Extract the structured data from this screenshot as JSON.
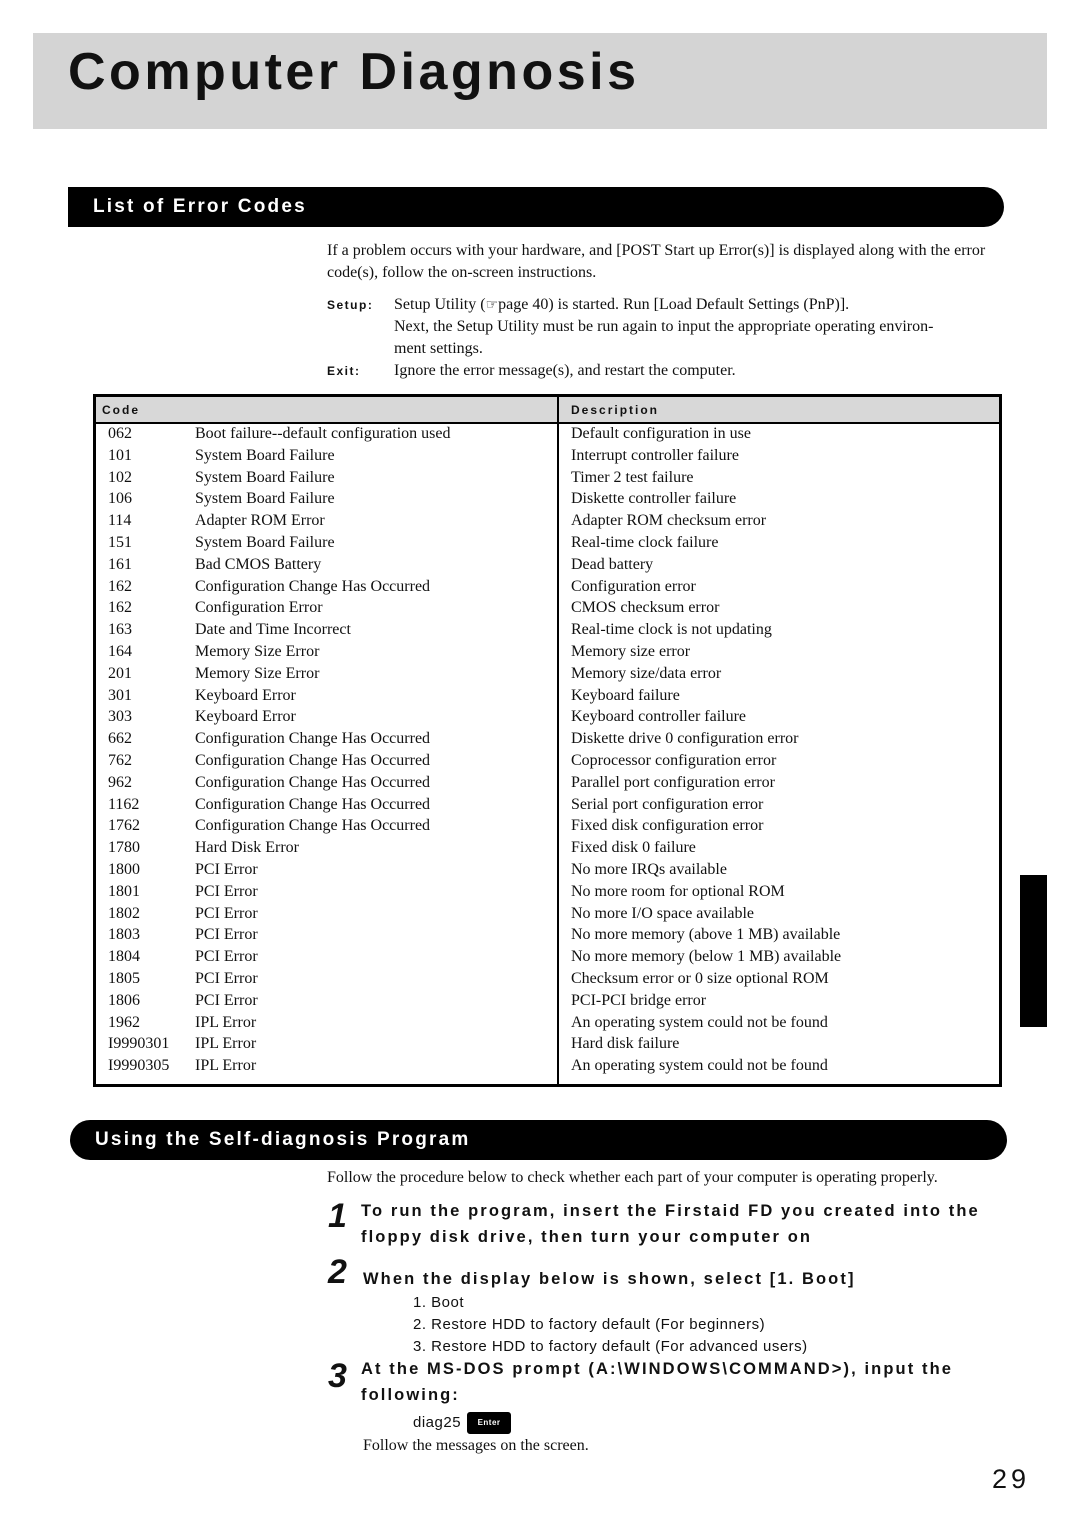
{
  "title": "Computer Diagnosis",
  "section1": {
    "heading": "List of Error Codes",
    "intro": "If a problem occurs with your hardware, and [POST Start up Error(s)] is displayed along with the error code(s), follow the on-screen instructions.",
    "setup_label": "Setup",
    "setup_line1_a": "Setup Utility (",
    "setup_icon": "pointing-hand-icon",
    "setup_line1_b": "page 40) is started. Run [Load Default Settings (PnP)].",
    "setup_line2": "Next, the Setup Utility must be run again to input the appropriate operating environ-",
    "setup_line3": "ment settings.",
    "exit_label": "Exit",
    "exit_text": "Ignore the error message(s), and restart the computer."
  },
  "table": {
    "headers": [
      "Code",
      "Description"
    ],
    "rows": [
      [
        "062",
        "Boot failure--default configuration used",
        "Default configuration in use"
      ],
      [
        "101",
        "System Board Failure",
        "Interrupt controller failure"
      ],
      [
        "102",
        "System Board Failure",
        "Timer 2 test failure"
      ],
      [
        "106",
        "System Board Failure",
        "Diskette controller failure"
      ],
      [
        "114",
        "Adapter ROM Error",
        "Adapter ROM checksum error"
      ],
      [
        "151",
        "System Board Failure",
        "Real-time clock failure"
      ],
      [
        "161",
        "Bad CMOS Battery",
        "Dead battery"
      ],
      [
        "162",
        "Configuration Change Has Occurred",
        "Configuration error"
      ],
      [
        "162",
        "Configuration Error",
        "CMOS checksum error"
      ],
      [
        "163",
        "Date and Time Incorrect",
        "Real-time clock is not updating"
      ],
      [
        "164",
        "Memory Size Error",
        "Memory size error"
      ],
      [
        "201",
        "Memory Size Error",
        "Memory size/data error"
      ],
      [
        "301",
        "Keyboard Error",
        "Keyboard failure"
      ],
      [
        "303",
        "Keyboard Error",
        "Keyboard controller failure"
      ],
      [
        "662",
        "Configuration Change Has Occurred",
        "Diskette drive 0 configuration error"
      ],
      [
        "762",
        "Configuration Change Has Occurred",
        "Coprocessor configuration error"
      ],
      [
        "962",
        "Configuration Change Has Occurred",
        "Parallel port configuration error"
      ],
      [
        "1162",
        "Configuration Change Has Occurred",
        "Serial port configuration error"
      ],
      [
        "1762",
        "Configuration Change Has Occurred",
        "Fixed disk configuration error"
      ],
      [
        "1780",
        "Hard Disk Error",
        "Fixed disk 0 failure"
      ],
      [
        "1800",
        "PCI Error",
        "No more IRQs available"
      ],
      [
        "1801",
        "PCI Error",
        "No more room for optional ROM"
      ],
      [
        "1802",
        "PCI Error",
        "No more I/O space available"
      ],
      [
        "1803",
        "PCI Error",
        "No more memory (above 1 MB) available"
      ],
      [
        "1804",
        "PCI Error",
        "No more memory (below 1 MB) available"
      ],
      [
        "1805",
        "PCI Error",
        "Checksum error or 0 size optional ROM"
      ],
      [
        "1806",
        "PCI Error",
        "PCI-PCI bridge error"
      ],
      [
        "1962",
        "IPL Error",
        "An operating system could not be found"
      ],
      [
        "I9990301",
        "IPL Error",
        "Hard disk failure"
      ],
      [
        "I9990305",
        "IPL Error",
        "An operating system could not be found"
      ]
    ]
  },
  "section2": {
    "heading": "Using the Self-diagnosis Program",
    "intro": "Follow the procedure below to check whether each part of your computer is operating properly.",
    "steps": [
      {
        "num": "1",
        "line1": "To run the program, insert the Firstaid FD you created into the",
        "line2": "floppy disk drive, then turn your computer on"
      },
      {
        "num": "2",
        "line1": "When the display below is shown, select [1. Boot]"
      },
      {
        "num": "3",
        "line1": "At the MS-DOS prompt (A:\\WINDOWS\\COMMAND>), input the",
        "line2": "following:"
      }
    ],
    "menu": [
      "1.  Boot",
      "2.  Restore HDD to factory default (For beginners)",
      "3.  Restore HDD to factory default (For advanced users)"
    ],
    "command": "diag25",
    "enter_key": "Enter",
    "enter_icon": "enter-key-icon",
    "follow": "Follow the messages on the screen."
  },
  "page_number": "29"
}
